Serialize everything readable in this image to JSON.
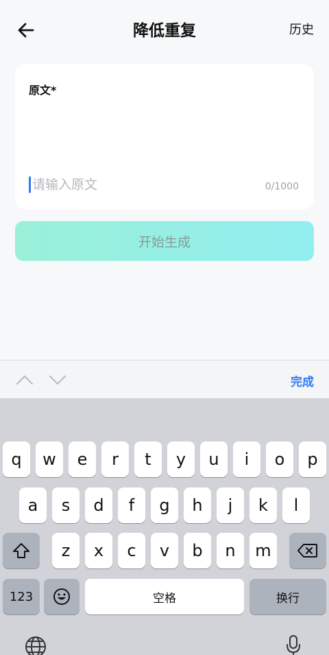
{
  "header": {
    "title": "降低重复",
    "history": "历史"
  },
  "card": {
    "label": "原文*",
    "placeholder": "请输入原文",
    "counter": "0/1000"
  },
  "generate_button": {
    "label": "开始生成"
  },
  "toolbar": {
    "done": "完成"
  },
  "keyboard": {
    "row1": [
      "q",
      "w",
      "e",
      "r",
      "t",
      "y",
      "u",
      "i",
      "o",
      "p"
    ],
    "row2": [
      "a",
      "s",
      "d",
      "f",
      "g",
      "h",
      "j",
      "k",
      "l"
    ],
    "row3": [
      "z",
      "x",
      "c",
      "v",
      "b",
      "n",
      "m"
    ],
    "numbers": "123",
    "space": "空格",
    "return": "换行"
  },
  "icons": {
    "back": "arrow-left-icon",
    "shift": "shift-icon",
    "delete": "backspace-icon",
    "emoji": "emoji-icon",
    "globe": "globe-icon",
    "mic": "microphone-icon"
  },
  "colors": {
    "accent": "#2f7bf5",
    "button_start": "#9af0d8",
    "button_end": "#92eef0"
  }
}
